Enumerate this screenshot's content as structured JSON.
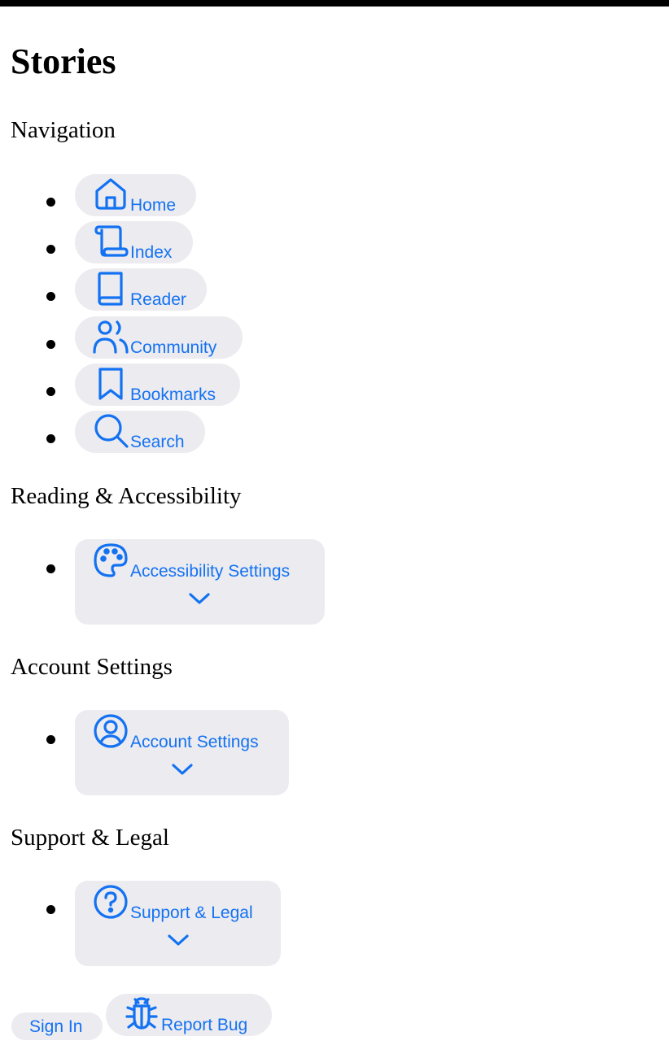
{
  "page": {
    "title": "Stories"
  },
  "colors": {
    "accent": "#1372f2",
    "pill_background": "#ecebef",
    "text": "#000000",
    "background": "#ffffff"
  },
  "sections": {
    "navigation": {
      "heading": "Navigation",
      "items": [
        {
          "label": "Home",
          "icon": "home-icon"
        },
        {
          "label": "Index",
          "icon": "scroll-icon"
        },
        {
          "label": "Reader",
          "icon": "book-icon"
        },
        {
          "label": "Community",
          "icon": "users-icon"
        },
        {
          "label": "Bookmarks",
          "icon": "bookmark-icon"
        },
        {
          "label": "Search",
          "icon": "search-icon"
        }
      ]
    },
    "reading": {
      "heading": "Reading & Accessibility",
      "dropdown": {
        "label": "Accessibility Settings",
        "icon": "palette-icon",
        "chevron": "chevron-down-icon"
      }
    },
    "account": {
      "heading": "Account Settings",
      "dropdown": {
        "label": "Account Settings",
        "icon": "user-circle-icon",
        "chevron": "chevron-down-icon"
      }
    },
    "support": {
      "heading": "Support & Legal",
      "dropdown": {
        "label": "Support & Legal",
        "icon": "help-circle-icon",
        "chevron": "chevron-down-icon"
      }
    }
  },
  "footer": {
    "sign_in_label": "Sign In",
    "report_bug_label": "Report Bug",
    "report_bug_icon": "bug-icon"
  }
}
